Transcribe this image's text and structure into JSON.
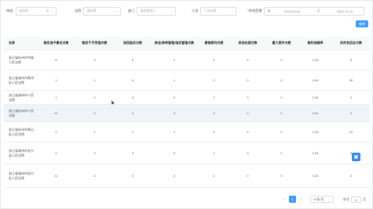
{
  "filters": {
    "region": {
      "label": "地区",
      "placeholder": "请选择"
    },
    "court": {
      "label": "法院",
      "placeholder": "请选择"
    },
    "department": {
      "label": "部门",
      "placeholder": "请选择部门"
    },
    "person": {
      "label": "人员",
      "placeholder": "人员选择"
    },
    "date_range": {
      "label": "时间范围",
      "start": "2023-01-01",
      "end": "2023-12-31",
      "separator": "至"
    }
  },
  "query_label": "查询",
  "table": {
    "columns": [
      "名称",
      "裁定准予撤诉次数",
      "裁定不予受理次数",
      "驳回起诉次数",
      "移送/移转管辖/指定管辖次数",
      "撤销原判次数",
      "其他处理次数",
      "重大案件次数",
      "裁判准确率",
      "改判发回总次数"
    ],
    "rows": [
      [
        "浙江省杭州市中级人民法院",
        "6",
        "3",
        "0",
        "1",
        "4",
        "0",
        "0",
        "0.00",
        "6"
      ],
      [
        "浙江省湖州市南浔区人民法院",
        "1",
        "1",
        "0",
        "1",
        "2",
        "0",
        "0",
        "0.00",
        "26"
      ],
      [
        "浙江省湖州市人民法院",
        "1",
        "0",
        "0",
        "0",
        "2",
        "0",
        "0",
        "0.00",
        "2"
      ],
      [
        "浙江省杭州市人民法院",
        "21",
        "0",
        "0",
        "0",
        "0",
        "0",
        "0",
        "0.00",
        "0"
      ],
      [
        "浙江省杭州市萧山区人民法院",
        "0",
        "1",
        "1",
        "1",
        "5",
        "0",
        "0",
        "0.00",
        "10"
      ],
      [
        "浙江省湖州市长兴县人民法院",
        "0",
        "3",
        "0",
        "0",
        "1",
        "0",
        "0",
        "0.00",
        "0"
      ],
      [
        "浙江省湖州市吴兴区人民法院",
        "11",
        "3",
        "0",
        "0",
        "4",
        "0",
        "0",
        "0.00",
        "0"
      ]
    ],
    "highlight_row": 3
  },
  "pagination": {
    "prev": "<",
    "current": "1",
    "next": ">",
    "page_size": "10条/页",
    "goto_label": "前往",
    "goto_value": "1",
    "page_suffix": "页"
  }
}
